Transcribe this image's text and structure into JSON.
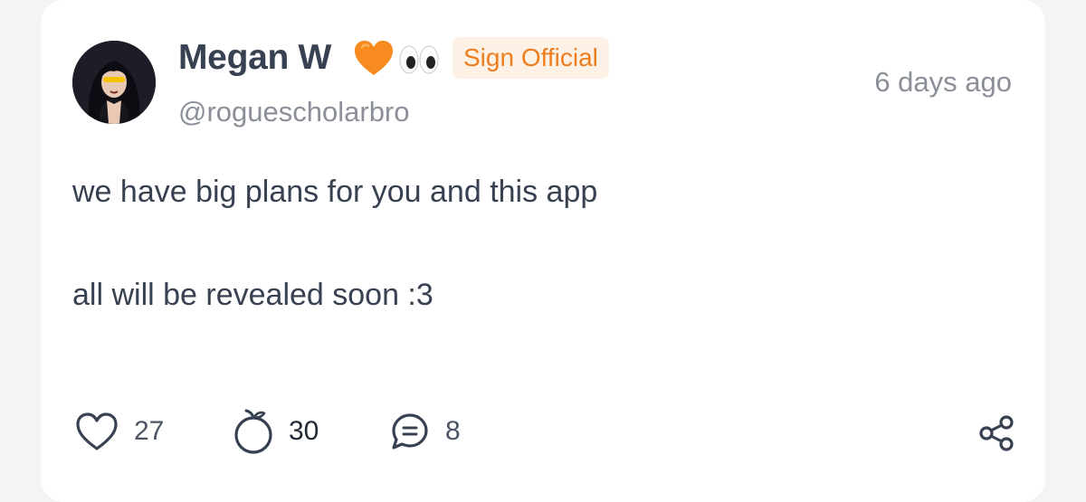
{
  "post": {
    "author": {
      "display_name": "Megan W",
      "emoji_heart": "orange-heart-emoji",
      "emoji_eyes": "eyes-emoji",
      "badge": "Sign Official",
      "handle": "@roguescholarbro",
      "avatar": "user-avatar"
    },
    "timestamp": "6 days ago",
    "body": {
      "line1": "we have big plans for you and this app",
      "line2": "all will be revealed soon :3"
    },
    "actions": {
      "likes": {
        "icon": "heart-icon",
        "count": "27"
      },
      "oranges": {
        "icon": "orange-icon",
        "count": "30"
      },
      "comments": {
        "icon": "comment-icon",
        "count": "8"
      },
      "share": {
        "icon": "share-icon"
      }
    }
  },
  "colors": {
    "card_bg": "#ffffff",
    "page_bg": "#f3f4f6",
    "name_text": "#374151",
    "muted_text": "#8b8f97",
    "badge_bg": "#fdf1e6",
    "badge_text": "#ee7d1e",
    "icon_stroke": "#374151"
  }
}
